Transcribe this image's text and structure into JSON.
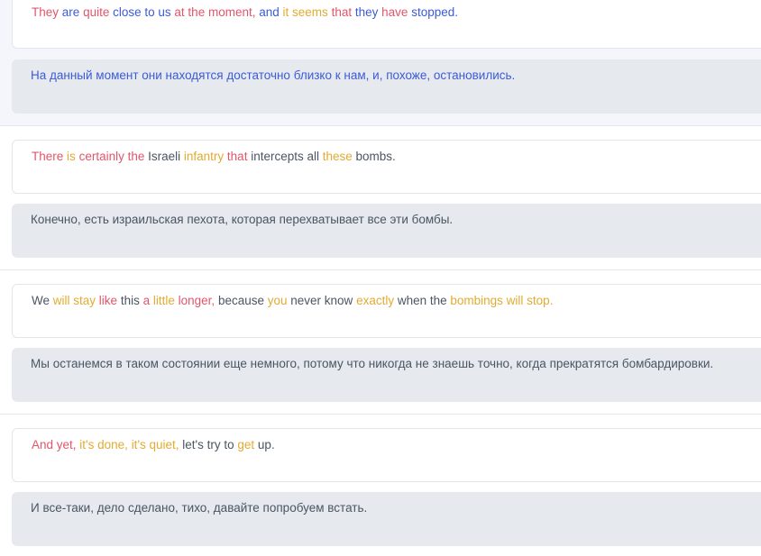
{
  "segments": [
    {
      "source_tokens": [
        {
          "t": "They",
          "c": "red"
        },
        {
          "t": " ",
          "c": "gray"
        },
        {
          "t": "are",
          "c": "blue"
        },
        {
          "t": " ",
          "c": "gray"
        },
        {
          "t": "quite",
          "c": "red"
        },
        {
          "t": " ",
          "c": "gray"
        },
        {
          "t": "close to us",
          "c": "blue"
        },
        {
          "t": " ",
          "c": "gray"
        },
        {
          "t": "at the moment,",
          "c": "red"
        },
        {
          "t": " ",
          "c": "gray"
        },
        {
          "t": "and",
          "c": "blue"
        },
        {
          "t": " ",
          "c": "gray"
        },
        {
          "t": "it seems",
          "c": "yellow"
        },
        {
          "t": " ",
          "c": "gray"
        },
        {
          "t": "that",
          "c": "red"
        },
        {
          "t": " ",
          "c": "gray"
        },
        {
          "t": "they",
          "c": "blue"
        },
        {
          "t": " ",
          "c": "gray"
        },
        {
          "t": "have",
          "c": "red"
        },
        {
          "t": " ",
          "c": "gray"
        },
        {
          "t": "stopped.",
          "c": "blue"
        }
      ],
      "translation": "На данный момент они находятся достаточно близко к нам, и, похоже, остановились.",
      "translation_color": "blue"
    },
    {
      "source_tokens": [
        {
          "t": "There",
          "c": "red"
        },
        {
          "t": " ",
          "c": "gray"
        },
        {
          "t": "is",
          "c": "yellow"
        },
        {
          "t": " ",
          "c": "gray"
        },
        {
          "t": "certainly the",
          "c": "red"
        },
        {
          "t": " Israeli ",
          "c": "gray"
        },
        {
          "t": "infantry",
          "c": "yellow"
        },
        {
          "t": " ",
          "c": "gray"
        },
        {
          "t": "that",
          "c": "red"
        },
        {
          "t": " intercepts all ",
          "c": "gray"
        },
        {
          "t": "these",
          "c": "yellow"
        },
        {
          "t": " bombs.",
          "c": "gray"
        }
      ],
      "translation": "Конечно, есть израильская пехота, которая перехватывает все эти бомбы.",
      "translation_color": "gray"
    },
    {
      "source_tokens": [
        {
          "t": "We ",
          "c": "gray"
        },
        {
          "t": "will stay",
          "c": "yellow"
        },
        {
          "t": " ",
          "c": "gray"
        },
        {
          "t": "like",
          "c": "red"
        },
        {
          "t": " this ",
          "c": "gray"
        },
        {
          "t": "a",
          "c": "red"
        },
        {
          "t": " ",
          "c": "gray"
        },
        {
          "t": "little",
          "c": "yellow"
        },
        {
          "t": " ",
          "c": "gray"
        },
        {
          "t": "longer,",
          "c": "red"
        },
        {
          "t": " because ",
          "c": "gray"
        },
        {
          "t": "you",
          "c": "yellow"
        },
        {
          "t": " never know ",
          "c": "gray"
        },
        {
          "t": "exactly",
          "c": "yellow"
        },
        {
          "t": " when the ",
          "c": "gray"
        },
        {
          "t": "bombings will stop.",
          "c": "yellow"
        }
      ],
      "translation": "Мы останемся в таком состоянии еще немного, потому что никогда не знаешь точно, когда прекратятся бомбардировки.",
      "translation_color": "gray"
    },
    {
      "source_tokens": [
        {
          "t": "And yet,",
          "c": "red"
        },
        {
          "t": " ",
          "c": "gray"
        },
        {
          "t": "it's done,",
          "c": "yellow"
        },
        {
          "t": " ",
          "c": "gray"
        },
        {
          "t": "it's quiet,",
          "c": "yellow"
        },
        {
          "t": " let's try to ",
          "c": "gray"
        },
        {
          "t": "get",
          "c": "yellow"
        },
        {
          "t": " up.",
          "c": "gray"
        }
      ],
      "translation": "И все-таки, дело сделано, тихо, давайте попробуем встать.",
      "translation_color": "gray"
    }
  ],
  "colors": {
    "red": "#e0566b",
    "blue": "#3c5bd6",
    "yellow": "#e2ab32",
    "gray": "#4b5563"
  }
}
